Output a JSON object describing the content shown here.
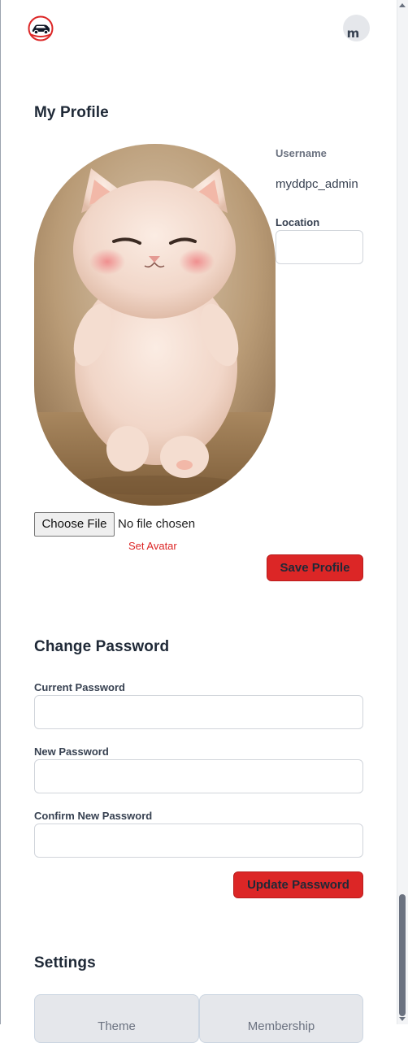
{
  "header": {
    "logo_icon": "car-logo-icon",
    "user_initial": "m"
  },
  "profile": {
    "title": "My Profile",
    "username_label": "Username",
    "username_value": "myddpc_admin",
    "location_label": "Location",
    "location_value": "",
    "choose_file_label": "Choose File",
    "file_status": "No file chosen",
    "set_avatar_label": "Set Avatar",
    "save_button": "Save Profile"
  },
  "password": {
    "title": "Change Password",
    "current_label": "Current Password",
    "new_label": "New Password",
    "confirm_label": "Confirm New Password",
    "update_button": "Update Password"
  },
  "settings": {
    "title": "Settings",
    "cards": [
      "Theme",
      "Membership"
    ]
  },
  "colors": {
    "accent": "#dc2626",
    "text": "#1f2937",
    "border": "#d1d5db"
  }
}
